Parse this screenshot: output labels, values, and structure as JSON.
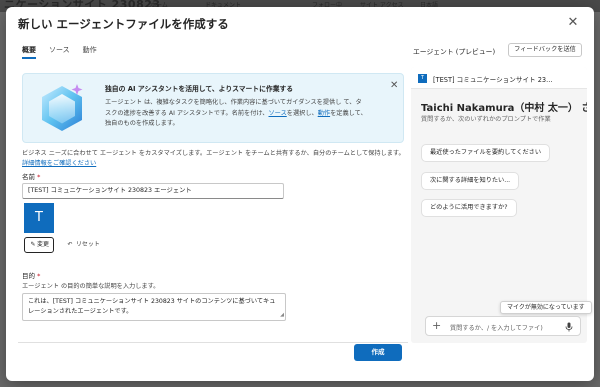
{
  "background": {
    "title": "ニケーションサイト 230823",
    "nav": [
      "ホーム",
      "ドキュメント",
      "フォロー中",
      "サイト アクセス",
      "日本語"
    ]
  },
  "dialog": {
    "title": "新しい エージェントファイルを作成する",
    "close_icon": "close-icon"
  },
  "tabs": [
    {
      "label": "概要",
      "active": true
    },
    {
      "label": "ソース",
      "active": false
    },
    {
      "label": "動作",
      "active": false
    }
  ],
  "banner": {
    "title": "独自の AI アシスタントを活用して、よりスマートに作業する",
    "body_1": "エージェント は、複雑なタスクを簡略化し、作業内容に基づいてガイダンスを提供し て、タスクの進捗を改善する AI アシスタントです。名前を付け、",
    "link_sources": "ソース",
    "body_2": "を選択し、",
    "link_behavior": "動作",
    "body_3": "を定義して、独自のものを作成します。"
  },
  "description": {
    "text": "ビジネス ニーズに合わせて エージェント をカスタマイズします。エージェント をチームと共有するか、自分のチームとして保持します。",
    "link": "詳細情報をご確認ください"
  },
  "name_field": {
    "label": "名前",
    "value": "[TEST] コミュニケーションサイト 230823 エージェント"
  },
  "avatar": {
    "letter": "T"
  },
  "icon_buttons": {
    "change": "変更",
    "reset": "リセット"
  },
  "purpose": {
    "label": "目的",
    "hint": "エージェント の目的の簡単な説明を入力します。",
    "value": "これは、[TEST] コミュニケーションサイト 230823 サイトのコンテンツに基づいてキュレーションされたエージェントです。"
  },
  "footer": {
    "create_label": "作成"
  },
  "preview": {
    "header": "エージェント (プレビュー)",
    "feedback_label": "フィードバックを送信",
    "tile_letter": "T",
    "agent_name": "[TEST] コミュニケーションサイト 23...",
    "greeting": "Taichi Nakamura（中村 太一） さん、",
    "subtitle": "質問するか、次のいずれかのプロンプトで作業",
    "suggestions": [
      "最近使ったファイルを要約してください",
      "次に関する詳細を知りたい...",
      "どのように活用できますか?"
    ],
    "tooltip": "マイクが無効になっています",
    "chat_placeholder": "質問するか、/ を入力してファイ)"
  },
  "colors": {
    "accent": "#0f6cbd",
    "banner_bg": "#e8f5fb",
    "preview_bg": "#f5f5f5"
  }
}
